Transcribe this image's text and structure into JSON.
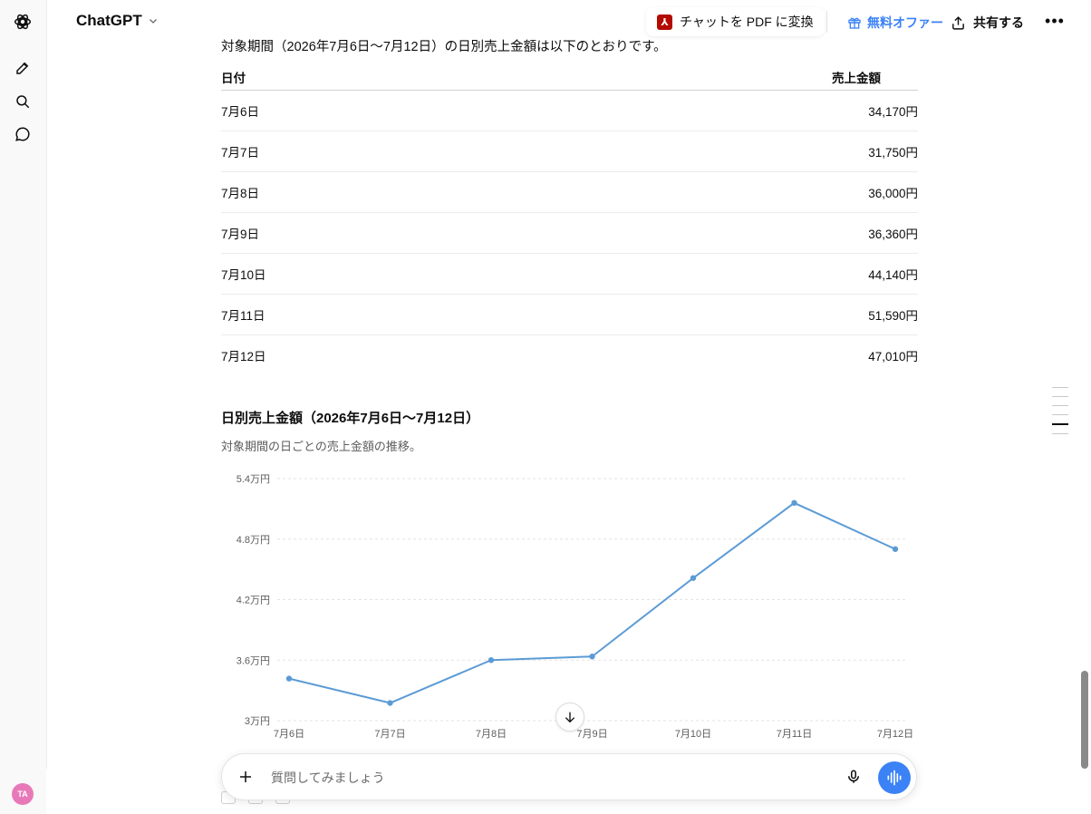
{
  "header": {
    "model_name": "ChatGPT",
    "pdf_button": "チャットを PDF に変換",
    "offer_button": "無料オファー",
    "share_button": "共有する",
    "avatar_initials": "TA"
  },
  "message": {
    "intro": "対象期間（2026年7月6日〜7月12日）の日別売上金額は以下のとおりです。",
    "table": {
      "headers": [
        "日付",
        "売上金額"
      ],
      "rows": [
        [
          "7月6日",
          "34,170円"
        ],
        [
          "7月7日",
          "31,750円"
        ],
        [
          "7月8日",
          "36,000円"
        ],
        [
          "7月9日",
          "36,360円"
        ],
        [
          "7月10日",
          "44,140円"
        ],
        [
          "7月11日",
          "51,590円"
        ],
        [
          "7月12日",
          "47,010円"
        ]
      ]
    }
  },
  "chart_data": {
    "type": "line",
    "title": "日別売上金額（2026年7月6日〜7月12日）",
    "subtitle": "対象期間の日ごとの売上金額の推移。",
    "categories": [
      "7月6日",
      "7月7日",
      "7月8日",
      "7月9日",
      "7月10日",
      "7月11日",
      "7月12日"
    ],
    "series": [
      {
        "values": [
          34170,
          31750,
          36000,
          36360,
          44140,
          51590,
          47010
        ],
        "color": "#5b9bd5"
      }
    ],
    "yticks": [
      30000,
      36000,
      42000,
      48000,
      54000
    ],
    "ytick_labels": [
      "3万円",
      "3.6万円",
      "4.2万円",
      "4.8万円",
      "5.4万円"
    ],
    "ylim": [
      30000,
      54000
    ],
    "grid": true
  },
  "composer": {
    "placeholder": "質問してみましょう"
  },
  "icons": {
    "logo": "openai-logo-icon",
    "new_chat": "new-chat-icon",
    "search": "search-icon",
    "chats": "chat-bubble-icon",
    "scroll_down": "arrow-down-icon",
    "mic": "microphone-icon",
    "voice": "voice-waveform-icon"
  }
}
